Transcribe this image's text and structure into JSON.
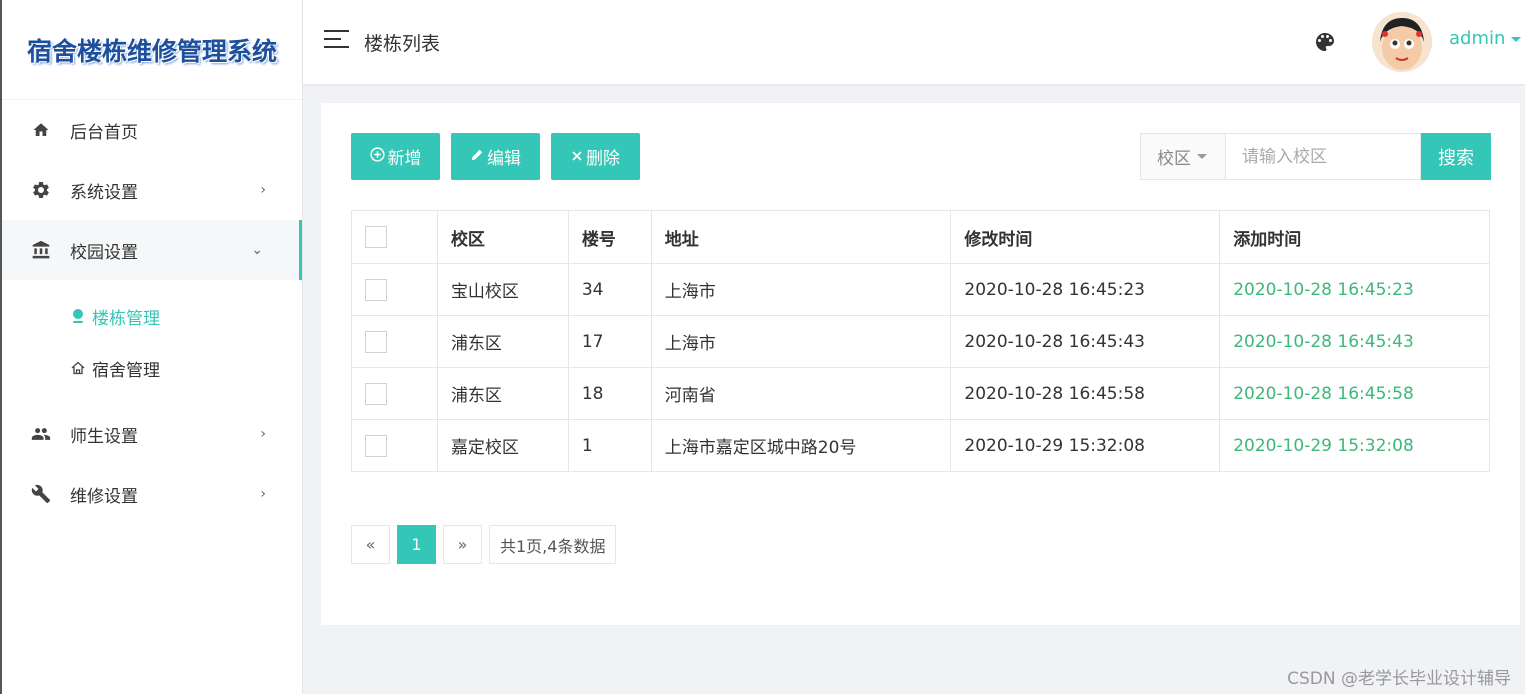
{
  "app": {
    "logo_text": "宿舍楼栋维修管理系统"
  },
  "sidebar": {
    "items": [
      {
        "label": "后台首页",
        "icon": "home-icon"
      },
      {
        "label": "系统设置",
        "icon": "gear-icon",
        "arrow": "›"
      },
      {
        "label": "校园设置",
        "icon": "bank-icon",
        "arrow": "⌄"
      },
      {
        "label": "师生设置",
        "icon": "users-icon",
        "arrow": "›"
      },
      {
        "label": "维修设置",
        "icon": "wrench-icon",
        "arrow": "›"
      }
    ],
    "sub_items": [
      {
        "label": "楼栋管理",
        "icon": "pin-icon"
      },
      {
        "label": "宿舍管理",
        "icon": "house-icon"
      }
    ]
  },
  "header": {
    "title": "楼栋列表",
    "username": "admin"
  },
  "toolbar": {
    "add_label": "新增",
    "edit_label": "编辑",
    "delete_label": "删除",
    "search_field": "校区",
    "search_placeholder": "请输入校区",
    "search_label": "搜索"
  },
  "table": {
    "headers": [
      "校区",
      "楼号",
      "地址",
      "修改时间",
      "添加时间"
    ],
    "rows": [
      {
        "campus": "宝山校区",
        "number": "34",
        "address": "上海市",
        "modified": "2020-10-28 16:45:23",
        "added": "2020-10-28 16:45:23"
      },
      {
        "campus": "浦东区",
        "number": "17",
        "address": "上海市",
        "modified": "2020-10-28 16:45:43",
        "added": "2020-10-28 16:45:43"
      },
      {
        "campus": "浦东区",
        "number": "18",
        "address": "河南省",
        "modified": "2020-10-28 16:45:58",
        "added": "2020-10-28 16:45:58"
      },
      {
        "campus": "嘉定校区",
        "number": "1",
        "address": "上海市嘉定区城中路20号",
        "modified": "2020-10-29 15:32:08",
        "added": "2020-10-29 15:32:08"
      }
    ]
  },
  "pager": {
    "prev": "«",
    "current": "1",
    "next": "»",
    "info": "共1页,4条数据"
  },
  "watermark": "CSDN @老学长毕业设计辅导",
  "colors": {
    "accent": "#34c6b6",
    "added_time": "#3cb878"
  }
}
